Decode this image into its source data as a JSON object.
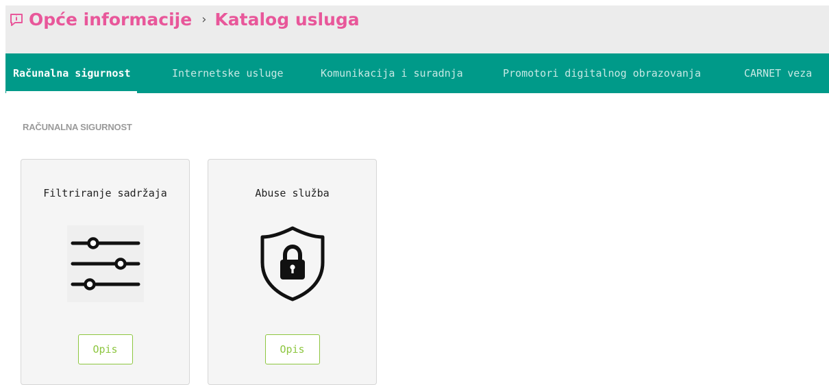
{
  "breadcrumb": {
    "parent": "Opće informacije",
    "current": "Katalog usluga"
  },
  "tabs": [
    {
      "label": "Računalna sigurnost",
      "active": true
    },
    {
      "label": "Internetske usluge",
      "active": false
    },
    {
      "label": "Komunikacija i suradnja",
      "active": false
    },
    {
      "label": "Promotori digitalnog obrazovanja",
      "active": false
    },
    {
      "label": "CARNET veza",
      "active": false
    }
  ],
  "section": {
    "title": "RAČUNALNA SIGURNOST"
  },
  "cards": [
    {
      "title": "Filtriranje sadržaja",
      "icon": "sliders-icon",
      "button": "Opis"
    },
    {
      "title": "Abuse služba",
      "icon": "shield-lock-icon",
      "button": "Opis"
    }
  ],
  "colors": {
    "accent_pink": "#e8579a",
    "tab_bar": "#009a89",
    "button_green": "#8dc63f"
  }
}
